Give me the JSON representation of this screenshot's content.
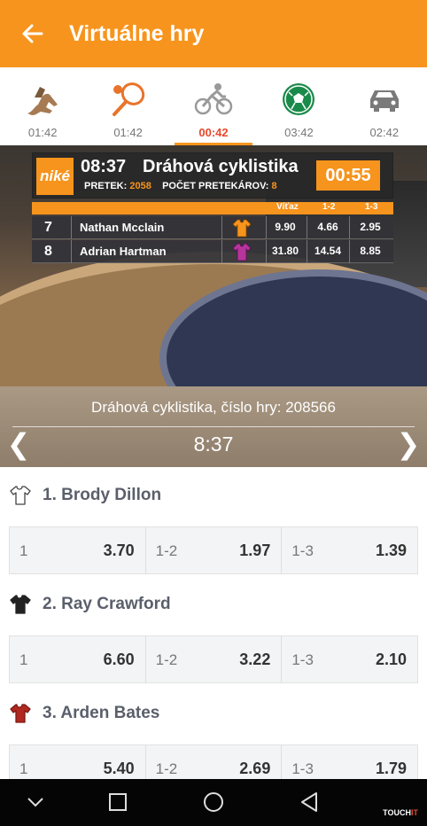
{
  "app_bar": {
    "title": "Virtuálne hry"
  },
  "tabs": [
    {
      "icon": "horse-racing-icon",
      "time": "01:42"
    },
    {
      "icon": "tennis-icon",
      "time": "01:42"
    },
    {
      "icon": "cycling-icon",
      "time": "00:42",
      "active": true
    },
    {
      "icon": "football-icon",
      "time": "03:42"
    },
    {
      "icon": "car-racing-icon",
      "time": "02:42"
    }
  ],
  "video": {
    "brand": "niké",
    "time": "08:37",
    "title": "Dráhová cyklistika",
    "race_label": "PRETEK:",
    "race_number": "2058",
    "racers_label": "POČET PRETEKÁROV:",
    "racers_count": "8",
    "countdown": "00:55",
    "columns": [
      "Víťaz",
      "1-2",
      "1-3"
    ],
    "rows": [
      {
        "num": "7",
        "name": "Nathan Mcclain",
        "jersey_color": "#f7941d",
        "odds": [
          "9.90",
          "4.66",
          "2.95"
        ]
      },
      {
        "num": "8",
        "name": "Adrian Hartman",
        "jersey_color": "#b5359c",
        "odds": [
          "31.80",
          "14.54",
          "8.85"
        ]
      }
    ]
  },
  "game_info": {
    "name": "Dráhová cyklistika, číslo hry: 208566",
    "clock": "8:37",
    "prev_label": "❮",
    "next_label": "❯"
  },
  "racers": [
    {
      "name": "1. Brody Dillon",
      "shirt_color": "#ffffff",
      "odds": [
        {
          "label": "1",
          "value": "3.70"
        },
        {
          "label": "1-2",
          "value": "1.97"
        },
        {
          "label": "1-3",
          "value": "1.39"
        }
      ]
    },
    {
      "name": "2. Ray Crawford",
      "shirt_color": "#222222",
      "odds": [
        {
          "label": "1",
          "value": "6.60"
        },
        {
          "label": "1-2",
          "value": "3.22"
        },
        {
          "label": "1-3",
          "value": "2.10"
        }
      ]
    },
    {
      "name": "3. Arden Bates",
      "shirt_color": "#b0281f",
      "odds": [
        {
          "label": "1",
          "value": "5.40"
        },
        {
          "label": "1-2",
          "value": "2.69"
        },
        {
          "label": "1-3",
          "value": "1.79"
        }
      ]
    }
  ],
  "watermark": {
    "a": "TOUCH",
    "b": "IT"
  }
}
